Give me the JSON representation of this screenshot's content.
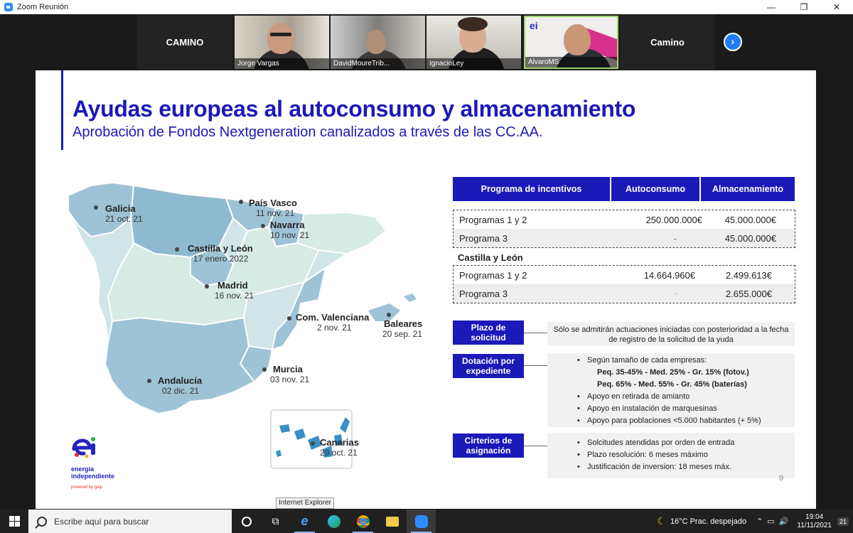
{
  "window": {
    "title": "Zoom Reunión",
    "minimize": "—",
    "maximize": "❐",
    "close": "✕"
  },
  "gallery": {
    "left_label": "CAMINO",
    "right_label": "Camino",
    "next": "›",
    "participants": [
      {
        "name": "Jorge Vargas"
      },
      {
        "name": "DavidMoureTrib..."
      },
      {
        "name": "IgnacioLey"
      },
      {
        "name": "AlvaroMS"
      }
    ]
  },
  "slide": {
    "title": "Ayudas europeas al autoconsumo y almacenamiento",
    "subtitle": "Aprobación de Fondos Nextgeneration canalizados a través de las CC.AA.",
    "regions": [
      {
        "name": "Galicia",
        "date": "21 oct. 21"
      },
      {
        "name": "País Vasco",
        "date": "11 nov. 21"
      },
      {
        "name": "Navarra",
        "date": "10 nov. 21"
      },
      {
        "name": "Castilla y León",
        "date": "17 enero 2022"
      },
      {
        "name": "Madrid",
        "date": "16 nov. 21"
      },
      {
        "name": "Com. Valenciana",
        "date": "2 nov. 21"
      },
      {
        "name": "Baleares",
        "date": "20 sep. 21"
      },
      {
        "name": "Murcia",
        "date": "03 nov. 21"
      },
      {
        "name": "Andalucía",
        "date": "02 dic. 21"
      },
      {
        "name": "Canarias",
        "date": "29 oct. 21"
      }
    ],
    "table": {
      "headers": [
        "Programa de incentivos",
        "Autoconsumo",
        "Almacenamiento"
      ],
      "general": [
        {
          "program": "Programas 1 y 2",
          "auto": "250.000.000€",
          "alm": "45.000.000€"
        },
        {
          "program": "Programa 3",
          "auto": "-",
          "alm": "45.000.000€"
        }
      ],
      "cyl_label": "Castilla y León",
      "cyl": [
        {
          "program": "Programas 1 y 2",
          "auto": "14.664.960€",
          "alm": "2.499.613€"
        },
        {
          "program": "Programa 3",
          "auto": "-",
          "alm": "2.655.000€"
        }
      ]
    },
    "plazo": {
      "label": "Plazo de solicitud",
      "text": "Sólo se admitirán actuaciones iniciadas con posterioridad a la fecha de registro de la solicitud de la yuda"
    },
    "dotacion": {
      "label": "Dotación por expediente",
      "items": [
        {
          "text": "Según tamaño de cada empresas:",
          "bullet": true,
          "bold": false
        },
        {
          "text": "Peq. 35-45% - Med. 25% - Gr. 15% (fotov.)",
          "bullet": false,
          "bold": true
        },
        {
          "text": "Peq. 65% - Med. 55% - Gr. 45% (baterías)",
          "bullet": false,
          "bold": true
        },
        {
          "text": "Apoyo en retirada de amianto",
          "bullet": true,
          "bold": false
        },
        {
          "text": "Apoyo en instalación de marquesinas",
          "bullet": true,
          "bold": false
        },
        {
          "text": "Apoyo para poblaciones <5.000 habitantes (+ 5%)",
          "bullet": true,
          "bold": false
        }
      ]
    },
    "criterios": {
      "label": "Cirterios de asignación",
      "items": [
        "Solcitudes atendidas por orden de entrada",
        "Plazo resolución: 6 meses máximo",
        "Justificación de inversion: 18 meses máx."
      ]
    },
    "logo": {
      "line1": "energía",
      "line2": "independiente",
      "powered": "powered by galp"
    },
    "page": "9"
  },
  "tooltip": "Internet Explorer",
  "taskbar": {
    "search_placeholder": "Escribe aquí para buscar",
    "weather": "16°C  Prac. despejado",
    "time": "19:04",
    "date": "11/11/2021",
    "notifications": "21"
  }
}
